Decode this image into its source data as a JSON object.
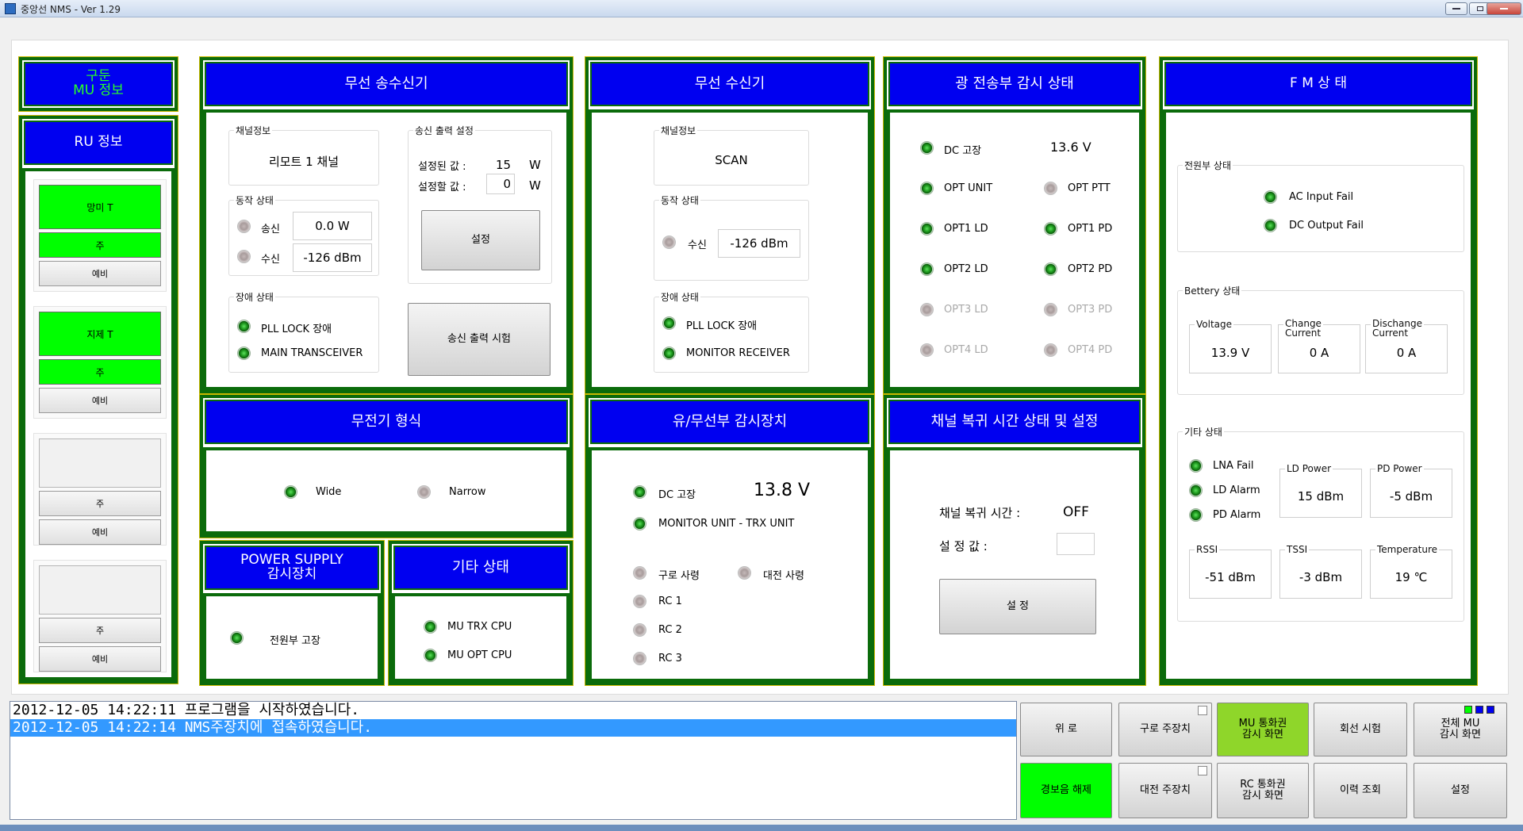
{
  "window": {
    "title": "중앙선 NMS  - Ver 1.29"
  },
  "left": {
    "header1": "구둔\nMU 정보",
    "header2": "RU 정보",
    "groups": [
      {
        "name": "망미 T",
        "main": "주",
        "spare": "예비",
        "active": true
      },
      {
        "name": "지제 T",
        "main": "주",
        "spare": "예비",
        "active": true
      },
      {
        "name": "",
        "main": "주",
        "spare": "예비",
        "active": false
      },
      {
        "name": "",
        "main": "주",
        "spare": "예비",
        "active": false
      }
    ]
  },
  "tx": {
    "title": "무선 송수신기",
    "channel_group": "채널정보",
    "channel": "리모트 1 채널",
    "op_group": "동작 상태",
    "send_label": "송신",
    "send_value": "0.0  W",
    "recv_label": "수신",
    "recv_value": "-126 dBm",
    "fault_group": "장애 상태",
    "fault1": "PLL LOCK 장애",
    "fault2": "MAIN TRANSCEIVER",
    "out_group": "송신 출력 설정",
    "set_label": "설정된 값 :",
    "set_value": "15",
    "set_unit": "W",
    "new_label": "설정할 값 :",
    "new_value": "0",
    "new_unit": "W",
    "set_button": "설정",
    "test_button": "송신 출력 시험"
  },
  "rx": {
    "title": "무선 수신기",
    "channel_group": "채널정보",
    "channel": "SCAN",
    "op_group": "동작 상태",
    "recv_label": "수신",
    "recv_value": "-126 dBm",
    "fault_group": "장애 상태",
    "fault1": "PLL LOCK 장애",
    "fault2": "MONITOR RECEIVER"
  },
  "opt": {
    "title": "광 전송부 감시 상태",
    "items": [
      {
        "left": "DC 고장",
        "left_on": true,
        "right": "13.6  V",
        "right_led": false
      },
      {
        "left": "OPT UNIT",
        "left_on": true,
        "right": "OPT PTT",
        "right_led": true,
        "right_on": false
      },
      {
        "left": "OPT1 LD",
        "left_on": true,
        "right": "OPT1 PD",
        "right_led": true,
        "right_on": true
      },
      {
        "left": "OPT2 LD",
        "left_on": true,
        "right": "OPT2 PD",
        "right_led": true,
        "right_on": true
      },
      {
        "left": "OPT3 LD",
        "left_on": false,
        "right": "OPT3 PD",
        "right_led": true,
        "right_on": false
      },
      {
        "left": "OPT4 LD",
        "left_on": false,
        "right": "OPT4 PD",
        "right_led": true,
        "right_on": false
      }
    ]
  },
  "fm": {
    "title": "F   M   상   태",
    "power_group": "전원부 상태",
    "ac": "AC Input Fail",
    "dc": "DC Output Fail",
    "battery_group": "Bettery 상태",
    "voltage_label": "Voltage",
    "voltage": "13.9   V",
    "change_label": "Change\nCurrent",
    "change": "0   A",
    "discharge_label": "Dischange\nCurrent",
    "discharge": "0   A",
    "etc_group": "기타 상태",
    "lna": "LNA Fail",
    "ld_alarm": "LD Alarm",
    "pd_alarm": "PD Alarm",
    "ld_power_label": "LD Power",
    "ld_power": "15  dBm",
    "pd_power_label": "PD Power",
    "pd_power": "-5  dBm",
    "rssi_label": "RSSI",
    "rssi": "-51  dBm",
    "tssi_label": "TSSI",
    "tssi": "-3  dBm",
    "temp_label": "Temperature",
    "temp": "19   ℃"
  },
  "radio_type": {
    "title": "무전기 형식",
    "wide": "Wide",
    "narrow": "Narrow"
  },
  "wired": {
    "title": "유/무선부 감시장치",
    "dc": "DC 고장",
    "dc_value": "13.8 V",
    "monitor": "MONITOR UNIT - TRX UNIT",
    "guro": "구로 사령",
    "daejeon": "대전 사령",
    "rc1": "RC 1",
    "rc2": "RC 2",
    "rc3": "RC 3"
  },
  "recovery": {
    "title": "채널 복귀 시간 상태 및 설정",
    "time_label": "채널 복귀 시간 :",
    "time_value": "OFF",
    "set_label": "설 정 값 :",
    "set_button": "설 정"
  },
  "power": {
    "title": "POWER SUPPLY\n감시장치",
    "fault": "전원부 고장"
  },
  "etc": {
    "title": "기타 상태",
    "trx": "MU TRX CPU",
    "opt": "MU OPT CPU"
  },
  "log": [
    "2012-12-05 14:22:11 프로그램을 시작하였습니다.",
    "2012-12-05 14:22:14 NMS주장치에 접속하였습니다."
  ],
  "buttons": {
    "up": "위 로",
    "guro": "구로 주장치",
    "mu_call": "MU 통화권\n감시 화면",
    "line_test": "회선 시험",
    "all_mu": "전체 MU\n감시 화면",
    "alarm_off": "경보음 해제",
    "daejeon": "대전 주장치",
    "rc_call": "RC 통화권\n감시 화면",
    "history": "이력 조회",
    "settings": "설정"
  },
  "colors": {
    "header": "#0000f0",
    "border": "#0b6b0b",
    "led_on": "#1e9a1e",
    "active": "#00ff00"
  }
}
